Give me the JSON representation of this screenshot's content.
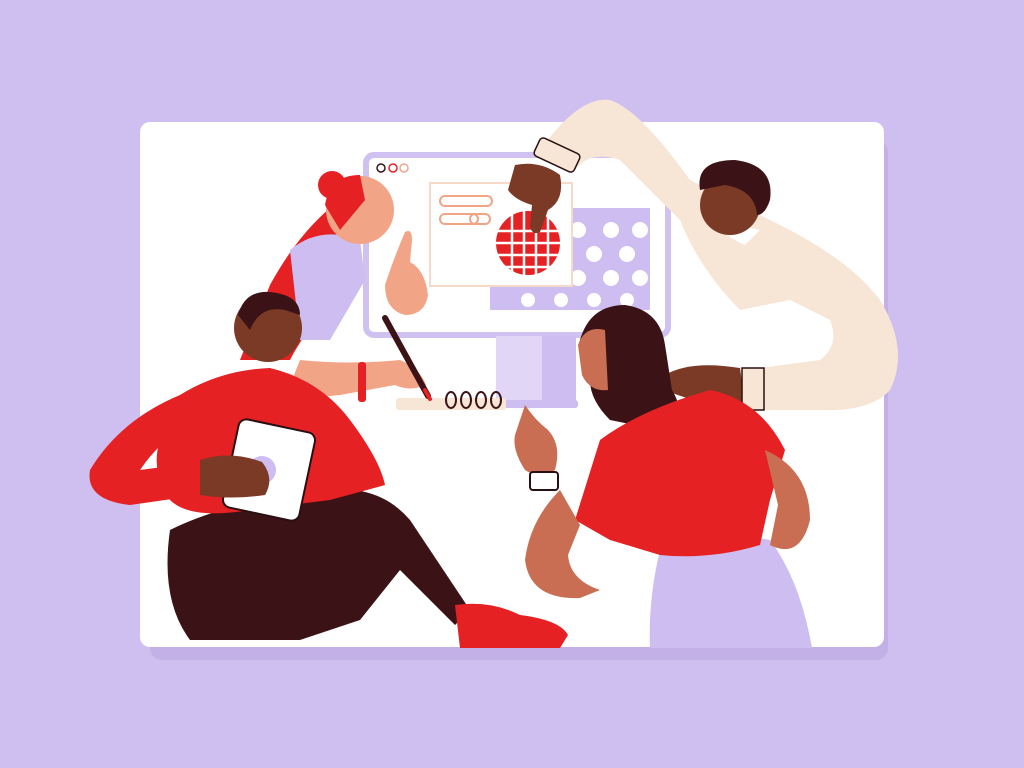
{
  "scene": {
    "description_free": true,
    "colors": {
      "background": "#CFBFF0",
      "card": "#FFFFFF",
      "card_shadow": "#B6A3E0",
      "red": "#E52124",
      "lavender": "#CDBDF0",
      "cream": "#F7E6D6",
      "dark_brown": "#3B1316",
      "skin_dark": "#7A3A26",
      "skin_medium": "#C96E52",
      "skin_light": "#F2A487",
      "outline": "#2A0F12",
      "screen_frame": "#CFC1F0",
      "window_mock": "#F5D9C9"
    },
    "icons": [
      "window-dots-icon",
      "globe-grid-icon",
      "spiral-notebook-icon",
      "tablet-icon",
      "pencil-icon",
      "watch-icon"
    ]
  }
}
